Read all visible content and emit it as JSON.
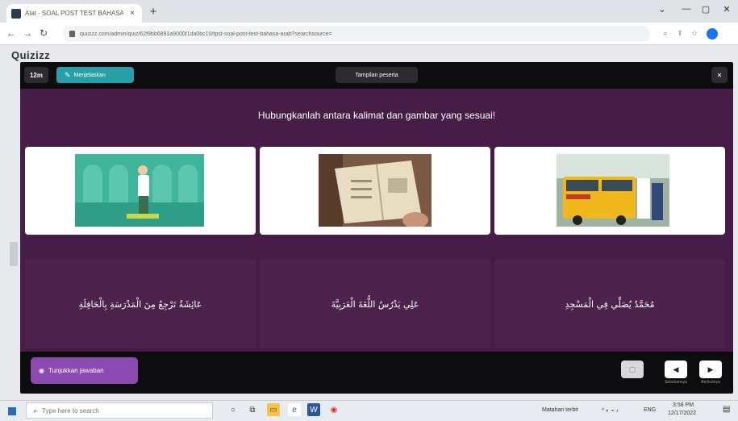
{
  "browser": {
    "tab_title": "Alat - SOAL POST TEST BAHASA",
    "tab_close": "×",
    "new_tab": "+",
    "url": "quizizz.com/admin/quiz/62f9bb6891a9000f1da0bc10/tpst-soal-post-test-bahasa-arab?searchsource=",
    "window_controls": [
      "⌄",
      "—",
      "▢",
      "✕"
    ]
  },
  "page": {
    "logo": "Quizizz"
  },
  "presenter": {
    "timer": "12m",
    "status_button": "Menjelaskan",
    "view_label": "Tampilan peserta",
    "close": "✕",
    "question": "Hubungkanlah antara kalimat dan gambar yang sesuai!",
    "image_cards": [
      {
        "icon": "praying-man-image"
      },
      {
        "icon": "open-book-image"
      },
      {
        "icon": "school-bus-image"
      }
    ],
    "answers": [
      "عَائِشَةُ تَرْجِعُ مِنَ الْمَدْرَسَةِ بِالْحَافِلَةِ",
      "عَلِي يَدْرُسُ اللُّغَةَ الْعَرَبِيَّةَ",
      "مُحَمَّدٌ يُصَلِّي فِي الْمَسْجِدِ"
    ],
    "reveal_button": "Tunjukkan jawaban",
    "nav": {
      "prev_label": "Sebelumnya",
      "next_label": "Berikutnya"
    }
  },
  "taskbar": {
    "search_placeholder": "Type here to search",
    "weather": "Matahari terbit",
    "tray_lang": "ENG",
    "time": "3:58 PM",
    "date": "12/17/2022"
  },
  "colors": {
    "panel": "#471c46",
    "answer_cell": "#4d224c",
    "accent_teal": "#2a9fa7",
    "accent_purple": "#8a4ab1"
  }
}
